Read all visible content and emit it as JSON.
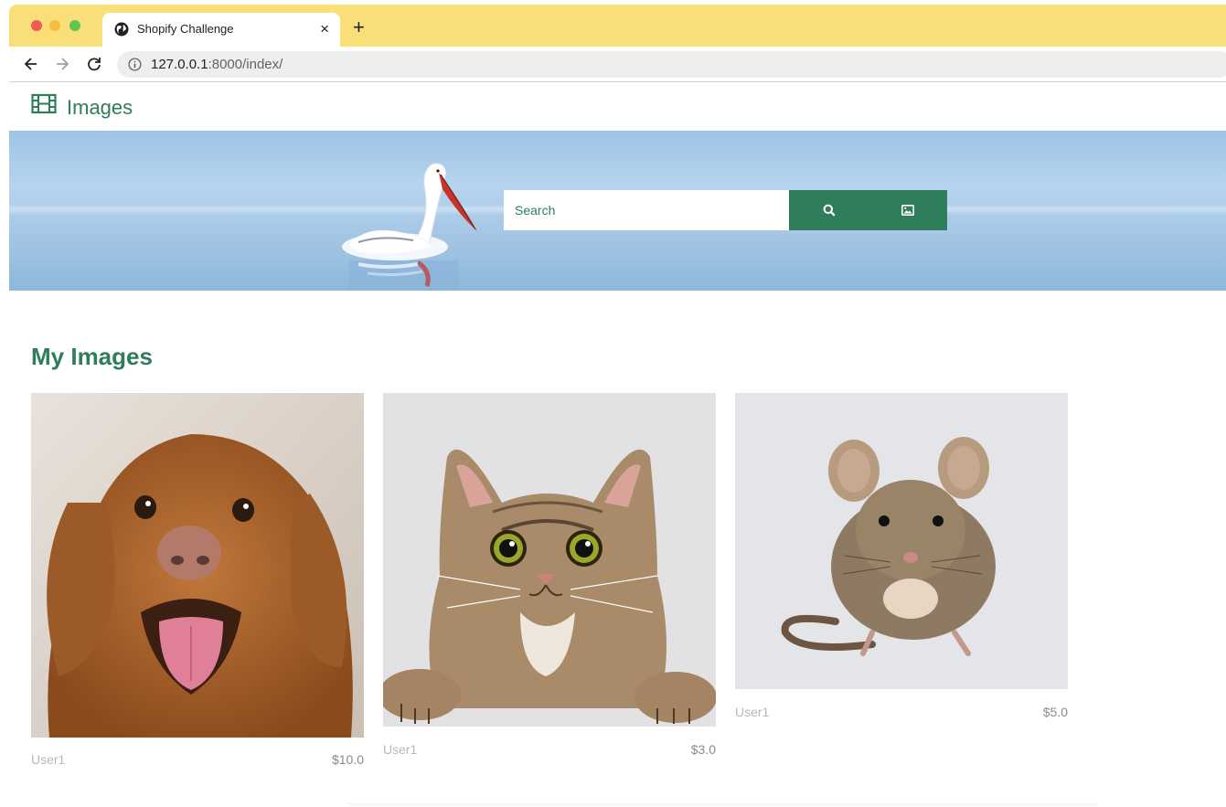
{
  "browser": {
    "tab_title": "Shopify Challenge",
    "tab_close": "×",
    "new_tab": "+",
    "url_host": "127.0.0.1",
    "url_rest": ":8000/index/"
  },
  "navbar": {
    "brand": "Images"
  },
  "hero": {
    "search_placeholder": "Search"
  },
  "section": {
    "title": "My Images"
  },
  "images": [
    {
      "subject": "dog",
      "user": "User1",
      "price": "$10.0"
    },
    {
      "subject": "cat",
      "user": "User1",
      "price": "$3.0"
    },
    {
      "subject": "mouse",
      "user": "User1",
      "price": "$5.0"
    }
  ],
  "colors": {
    "accent": "#2e7d5b",
    "tabbar": "#fadf78"
  }
}
